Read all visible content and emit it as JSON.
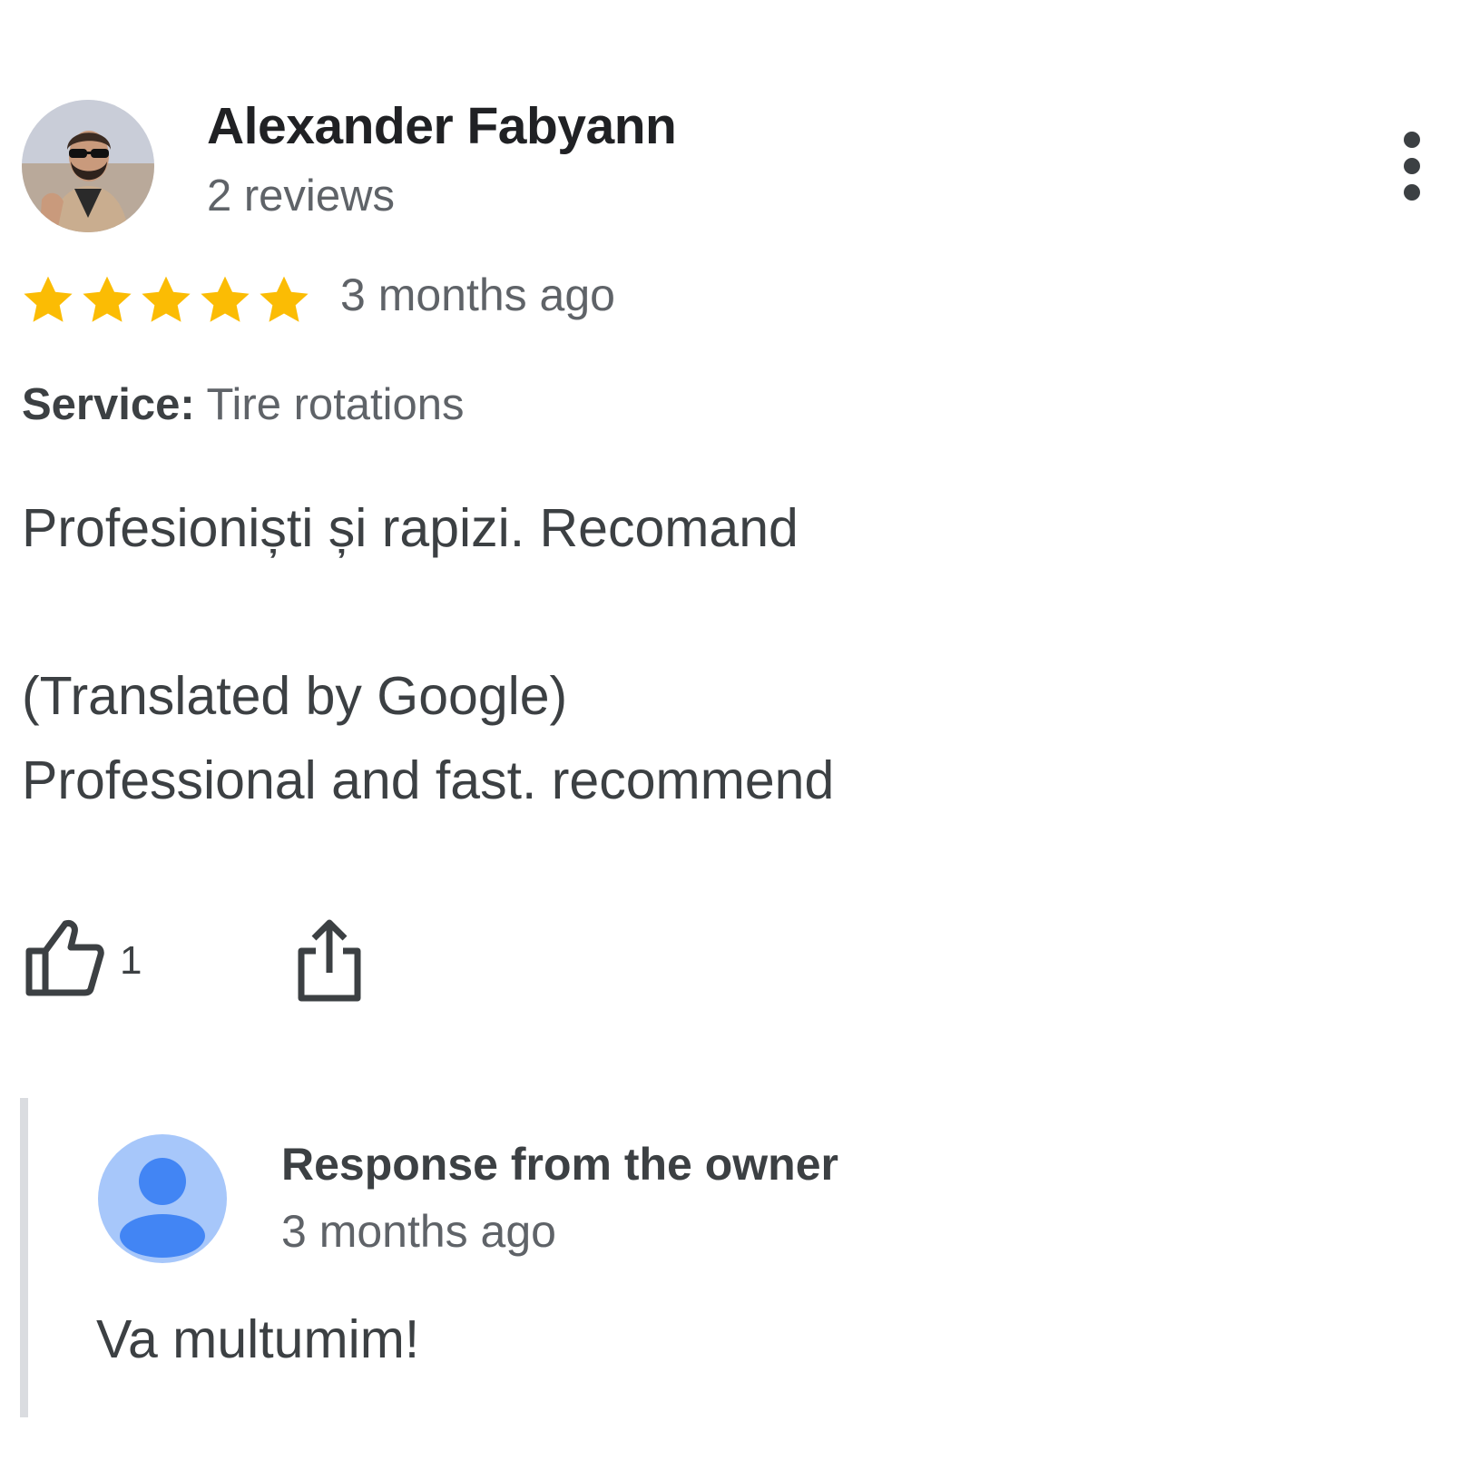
{
  "review": {
    "author_name": "Alexander Fabyann",
    "author_reviews": "2 reviews",
    "avatar_icon": "user-photo",
    "more_icon": "more-vert-icon",
    "rating": 5,
    "rating_max": 5,
    "star_color": "#fbbc04",
    "date": "3 months ago",
    "service_label": "Service:",
    "service_value": "Tire rotations",
    "text_original": "Profesioniști și rapizi. Recomand",
    "translated_tag": "(Translated by Google)",
    "text_translated": "Professional and fast. recommend",
    "like_icon": "thumb-up-icon",
    "like_count": "1",
    "share_icon": "share-icon"
  },
  "owner_response": {
    "avatar_icon": "person-icon",
    "avatar_color": "#a7c7fa",
    "avatar_figure_color": "#4285f4",
    "title": "Response from the owner",
    "date": "3 months ago",
    "text": "Va multumim!"
  }
}
